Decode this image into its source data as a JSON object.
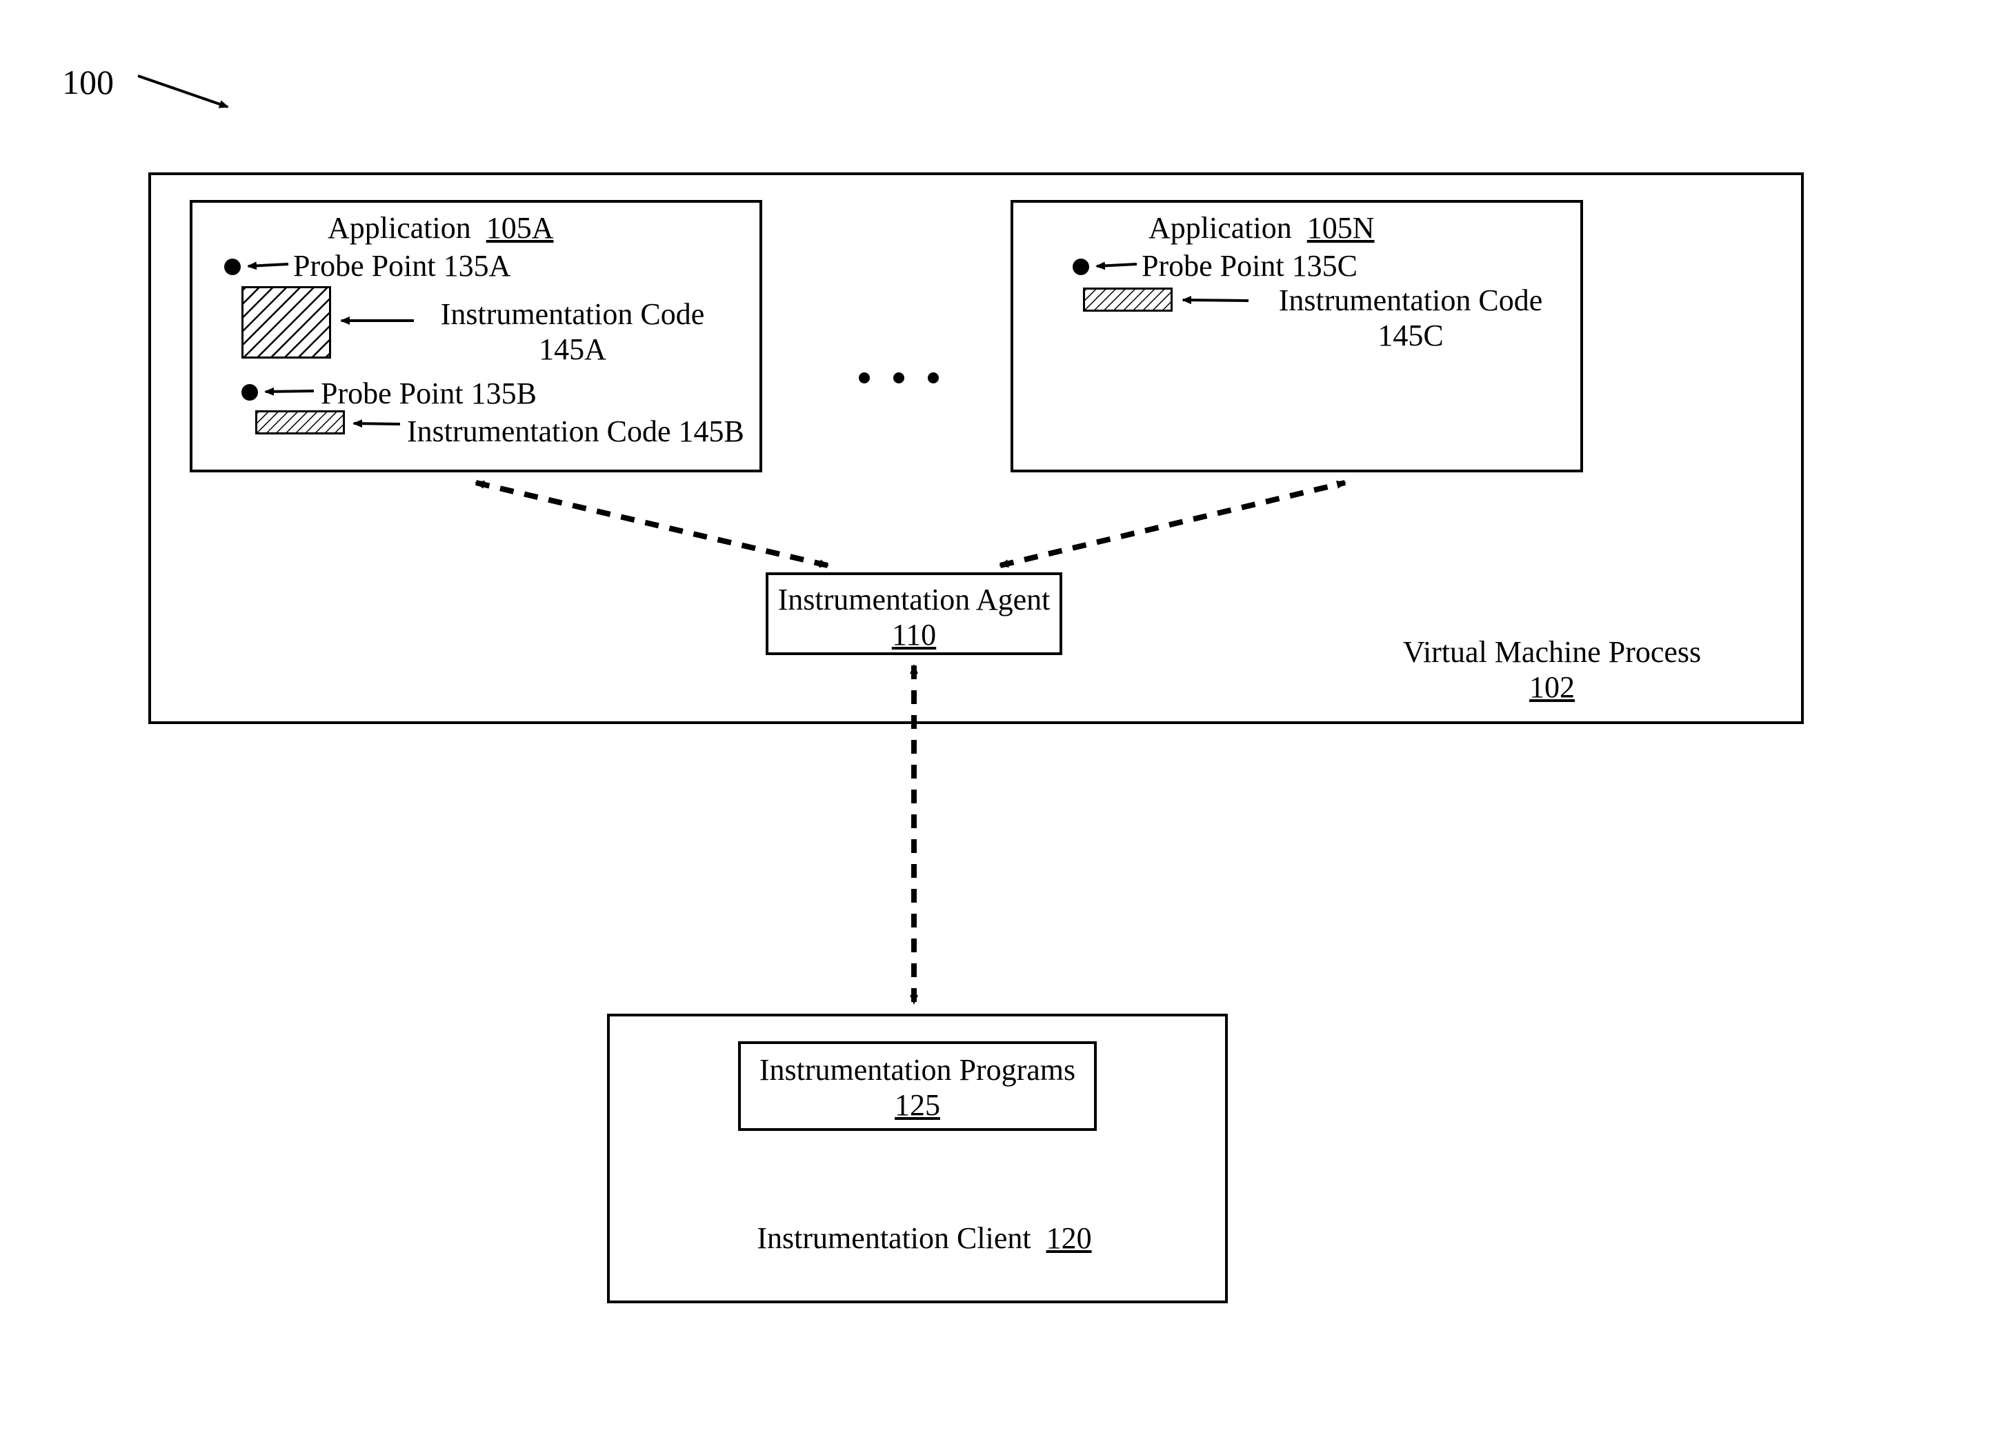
{
  "figureNumber": "100",
  "vmProcess": {
    "label": "Virtual Machine Process",
    "num": "102"
  },
  "appA": {
    "title": "Application",
    "num": "105A",
    "probe1": "Probe Point 135A",
    "code1a": "Instrumentation Code",
    "code1b": "145A",
    "probe2": "Probe Point 135B",
    "code2": "Instrumentation Code 145B"
  },
  "appN": {
    "title": "Application",
    "num": "105N",
    "probe1": "Probe Point 135C",
    "code1a": "Instrumentation Code",
    "code1b": "145C"
  },
  "agent": {
    "label": "Instrumentation Agent",
    "num": "110"
  },
  "client": {
    "label": "Instrumentation Client",
    "num": "120"
  },
  "programs": {
    "label": "Instrumentation Programs",
    "num": "125"
  }
}
